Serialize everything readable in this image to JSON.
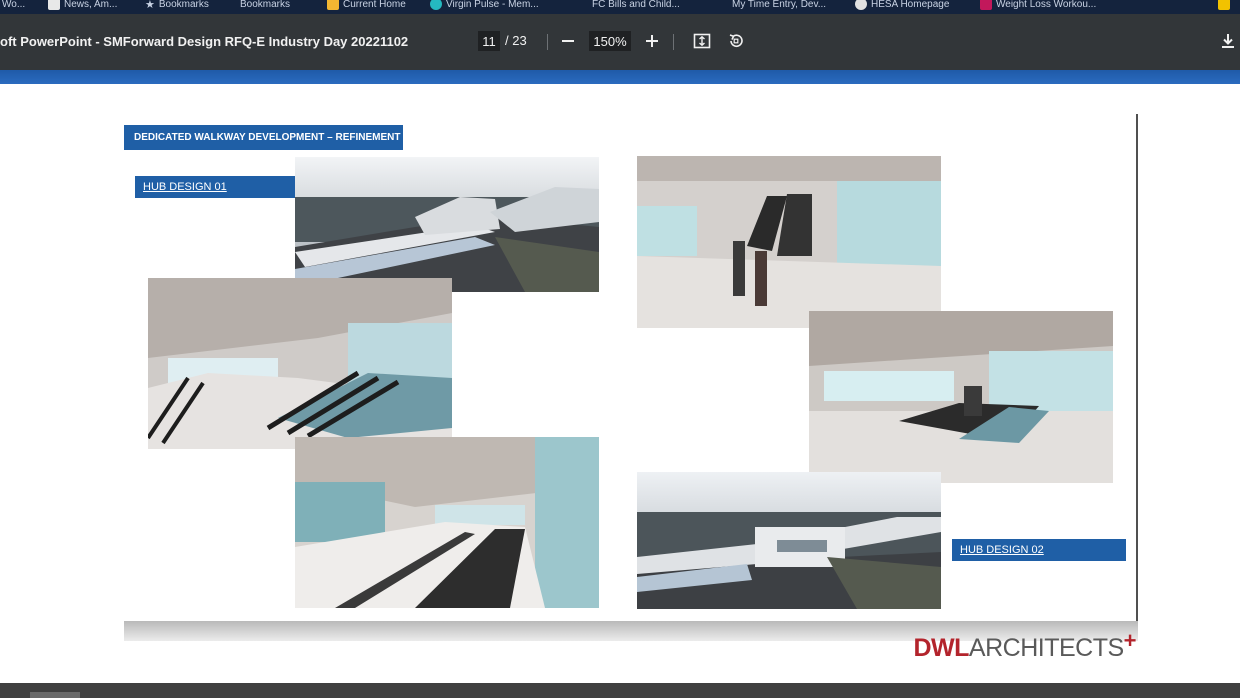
{
  "bookmarks": [
    {
      "label": "Wo...",
      "color": "#d9d9d9"
    },
    {
      "label": "News, Am...",
      "color": "#e8e8e8"
    },
    {
      "label": "Bookmarks",
      "color": "#cfd8e6"
    },
    {
      "label": "Bookmarks",
      "color": "#cfd8e6"
    },
    {
      "label": "Current Home",
      "color": "#f2b632"
    },
    {
      "label": "Virgin Pulse - Mem...",
      "color": "#25b9c0"
    },
    {
      "label": "FC Bills and Child...",
      "color": "#3a6fcf"
    },
    {
      "label": "My Time Entry, Dev...",
      "color": "#4a7ad8"
    },
    {
      "label": "HESA Homepage",
      "color": "#e1e1e1"
    },
    {
      "label": "Weight Loss Workou...",
      "color": "#c2185b"
    }
  ],
  "toolbar": {
    "title": "oft PowerPoint - SMForward Design RFQ-E Industry Day 20221102",
    "page_current": "11",
    "page_total": "/ 23",
    "zoom": "150%",
    "zoom_out_symbol": "—",
    "zoom_in_symbol": "+"
  },
  "slide": {
    "heading": "DEDICATED WALKWAY DEVELOPMENT – REFINEMENT",
    "hub1_label": "HUB DESIGN 01",
    "hub2_label": "HUB DESIGN 02",
    "logo_dwl": "DWL",
    "logo_architects": "ARCHITECTS",
    "logo_plus": "+"
  },
  "colors": {
    "toolbar_bg": "#323639",
    "accent_blue": "#1f5fa6",
    "logo_red": "#b3242c"
  }
}
